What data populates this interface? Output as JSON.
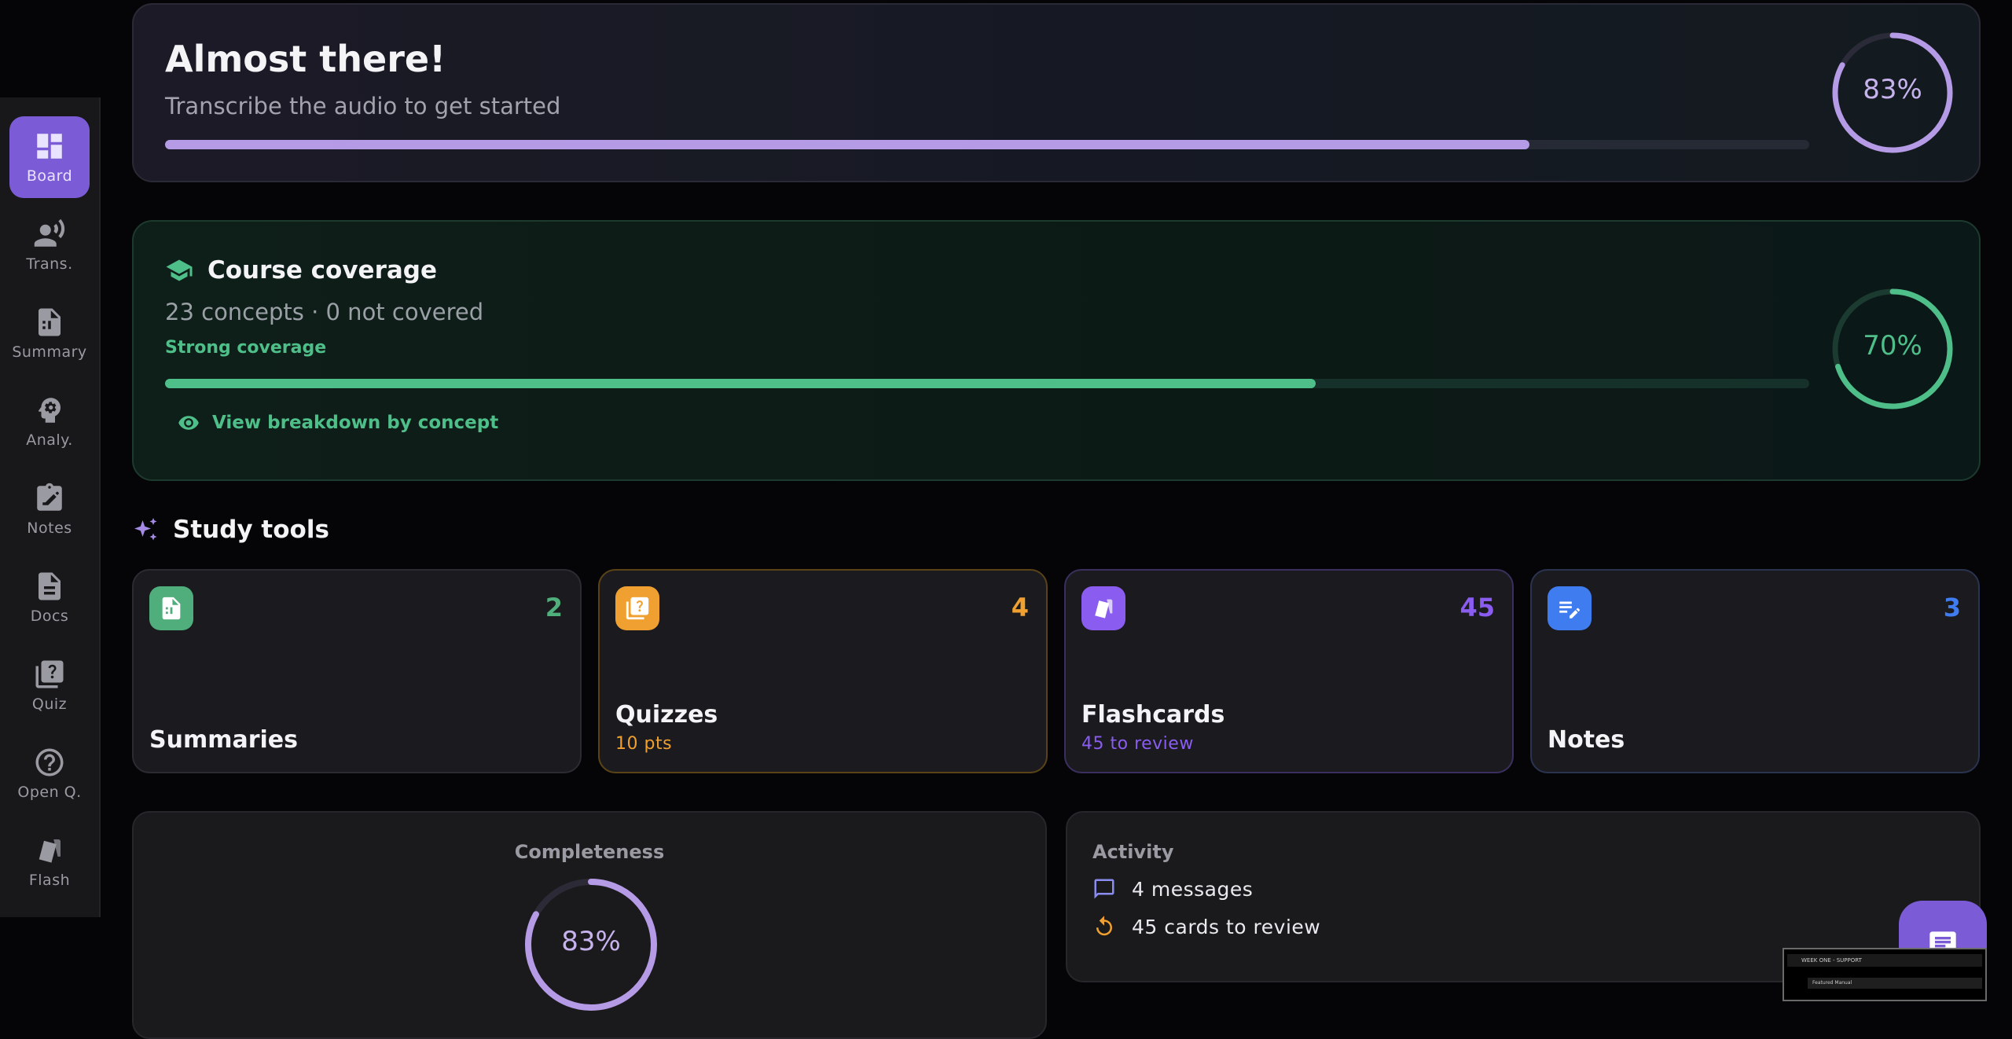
{
  "sidebar": {
    "items": [
      {
        "label": "Board",
        "icon": "dashboard-icon",
        "active": true
      },
      {
        "label": "Trans.",
        "icon": "record-voice-icon"
      },
      {
        "label": "Summary",
        "icon": "summary-doc-icon"
      },
      {
        "label": "Analy.",
        "icon": "psychology-icon"
      },
      {
        "label": "Notes",
        "icon": "edit-note-icon"
      },
      {
        "label": "Docs",
        "icon": "document-icon"
      },
      {
        "label": "Quiz",
        "icon": "quiz-icon"
      },
      {
        "label": "Open Q.",
        "icon": "help-circle-icon"
      },
      {
        "label": "Flash",
        "icon": "flashcards-icon"
      }
    ]
  },
  "hero": {
    "title": "Almost there!",
    "subtitle": "Transcribe the audio to get started",
    "progress": 0.83,
    "percent_label": "83%",
    "color": "#b59ae6"
  },
  "coverage": {
    "icon": "school-icon",
    "title": "Course coverage",
    "stats": "23 concepts · 0 not covered",
    "status": "Strong coverage",
    "progress": 0.7,
    "percent_label": "70%",
    "link_icon": "eye-icon",
    "link_label": "View breakdown by concept",
    "color": "#4fbf8a"
  },
  "study_tools": {
    "title": "Study tools",
    "icon": "sparkle-icon",
    "tools": [
      {
        "name": "Summaries",
        "count": "2",
        "subtitle": "",
        "icon": "summary-doc-icon",
        "color": "#4fae7c"
      },
      {
        "name": "Quizzes",
        "count": "4",
        "subtitle": "10 pts",
        "icon": "quiz-icon",
        "color": "#f0a030"
      },
      {
        "name": "Flashcards",
        "count": "45",
        "subtitle": "45 to review",
        "icon": "flashcards-icon",
        "color": "#8a5cf0"
      },
      {
        "name": "Notes",
        "count": "3",
        "subtitle": "",
        "icon": "edit-note-icon",
        "color": "#3f7cf0"
      }
    ]
  },
  "completeness": {
    "title": "Completeness",
    "progress": 0.83,
    "percent_label": "83%"
  },
  "activity": {
    "title": "Activity",
    "items": [
      {
        "icon": "chat-icon",
        "label": "4 messages"
      },
      {
        "icon": "refresh-icon",
        "label": "45 cards to review"
      }
    ]
  },
  "preview": {
    "title": "WEEK ONE - SUPPORT",
    "row": "Featured Manual"
  }
}
